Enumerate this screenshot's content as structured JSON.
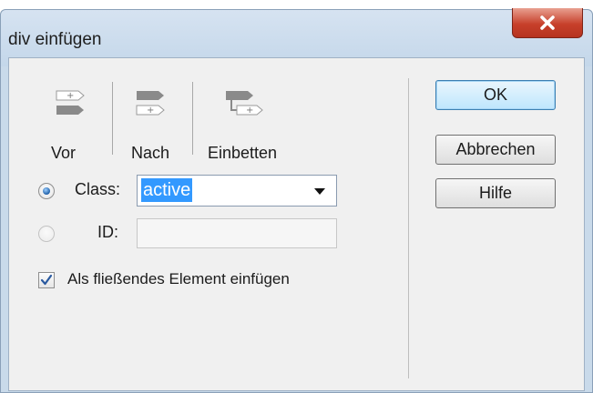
{
  "window": {
    "title": "div einfügen"
  },
  "insert_modes": [
    {
      "label": "Vor",
      "icon": "insert-before-icon"
    },
    {
      "label": "Nach",
      "icon": "insert-after-icon"
    },
    {
      "label": "Einbetten",
      "icon": "insert-nested-icon"
    }
  ],
  "class_row": {
    "label": "Class:",
    "value": "active",
    "selected": true
  },
  "id_row": {
    "label": "ID:",
    "value": "",
    "selected": false
  },
  "float_option": {
    "label": "Als fließendes Element einfügen",
    "checked": true
  },
  "buttons": {
    "ok": "OK",
    "cancel": "Abbrechen",
    "help": "Hilfe"
  },
  "colors": {
    "selection": "#3399ff",
    "close_button": "#c7402b",
    "default_button_border": "#3c7fb1"
  }
}
